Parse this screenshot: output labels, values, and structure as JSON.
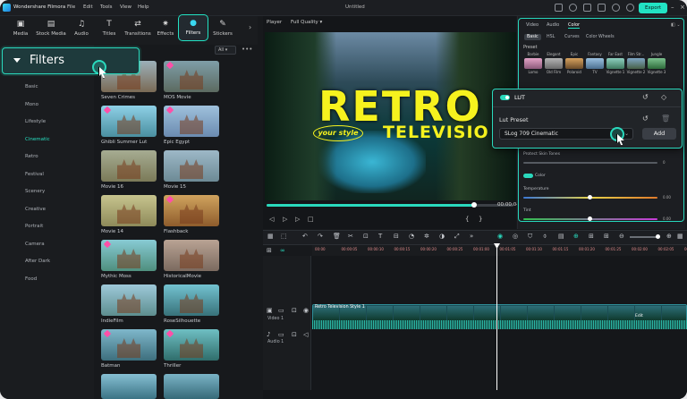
{
  "titlebar": {
    "app_name": "Wondershare Filmora",
    "menus": [
      "File",
      "Edit",
      "Tools",
      "View",
      "Help"
    ],
    "doc_title": "Untitled",
    "export_label": "Export"
  },
  "tool_tabs": [
    {
      "label": "Media",
      "icon": "media-icon"
    },
    {
      "label": "Stock Media",
      "icon": "stock-media-icon"
    },
    {
      "label": "Audio",
      "icon": "audio-icon"
    },
    {
      "label": "Titles",
      "icon": "titles-icon"
    },
    {
      "label": "Transitions",
      "icon": "transitions-icon"
    },
    {
      "label": "Effects",
      "icon": "effects-icon"
    },
    {
      "label": "Filters",
      "icon": "filters-icon",
      "active": true
    },
    {
      "label": "Stickers",
      "icon": "stickers-icon"
    }
  ],
  "filters_callout": {
    "label": "Filters"
  },
  "categories": [
    "Basic",
    "Mono",
    "Lifestyle",
    "Cinematic",
    "Retro",
    "Festival",
    "Scenery",
    "Creative",
    "Portrait",
    "Camera",
    "After Dark",
    "Food"
  ],
  "active_category": "Cinematic",
  "grid": {
    "filter_value": "All"
  },
  "thumbnails": [
    {
      "label": "Seven Crimes",
      "fav": false
    },
    {
      "label": "MOS Movie",
      "fav": true
    },
    {
      "label": "Ghibli Summer Lut",
      "fav": true
    },
    {
      "label": "Epic Egypt",
      "fav": true
    },
    {
      "label": "Movie 16",
      "fav": false
    },
    {
      "label": "Movie 15",
      "fav": false
    },
    {
      "label": "Movie 14",
      "fav": false
    },
    {
      "label": "Flashback",
      "fav": true
    },
    {
      "label": "Mythic Moss",
      "fav": true
    },
    {
      "label": "HistoricalMovie",
      "fav": false
    },
    {
      "label": "IndieFilm",
      "fav": false
    },
    {
      "label": "RoseSilhouette",
      "fav": false
    },
    {
      "label": "Batman",
      "fav": true
    },
    {
      "label": "Thriller",
      "fav": true
    },
    {
      "label": "",
      "fav": false
    },
    {
      "label": "",
      "fav": false
    }
  ],
  "player": {
    "label": "Player",
    "quality": "Full Quality",
    "title_big": "RETRO",
    "title_badge": "your style",
    "title_sub": "TELEVISIO",
    "timecode": "00:00:04",
    "progress": 0.84
  },
  "right_panel": {
    "tabs": [
      "Video",
      "Audio",
      "Color"
    ],
    "active_tab": "Color",
    "subtabs": [
      "Basic",
      "HSL",
      "Curves",
      "Color Wheels"
    ],
    "active_subtab": "Basic",
    "preset_label": "Preset",
    "presets": [
      {
        "name": "Barbie",
        "bottom": "Lomo"
      },
      {
        "name": "Elegant",
        "bottom": "Old Film"
      },
      {
        "name": "Epic",
        "bottom": "Polaroid"
      },
      {
        "name": "Fantasy",
        "bottom": "TV"
      },
      {
        "name": "Far East",
        "bottom": "Vignette 1"
      },
      {
        "name": "Film Str...",
        "bottom": "Vignette 2"
      },
      {
        "name": "Jungle",
        "bottom": "Vignette 3"
      }
    ],
    "protect_skin_label": "Protect Skin Tones",
    "color_label": "Color",
    "temperature_label": "Temperature",
    "temperature_value": "0.00",
    "tint_label": "Tint",
    "tint_value": "0.00",
    "protect_value": "0"
  },
  "lut": {
    "title": "LUT",
    "preset_label": "Lut Preset",
    "selected": "SLog 709 Cinematic",
    "add_label": "Add"
  },
  "timeline": {
    "ticks": [
      "00:00",
      "00:00:05",
      "00:00:10",
      "00:00:15",
      "00:00:20",
      "00:00:25",
      "00:01:00",
      "00:01:05",
      "00:01:10",
      "00:01:15",
      "00:01:20",
      "00:01:25",
      "00:02:00",
      "00:02:05",
      "00:02:10"
    ],
    "clip_title": "Retro Television Style 1",
    "video_track": "Video 1",
    "audio_track": "Audio 1",
    "edit_tip": "Edit"
  },
  "colors": {
    "accent": "#22e3c4",
    "title_yellow": "#f6f21e"
  }
}
